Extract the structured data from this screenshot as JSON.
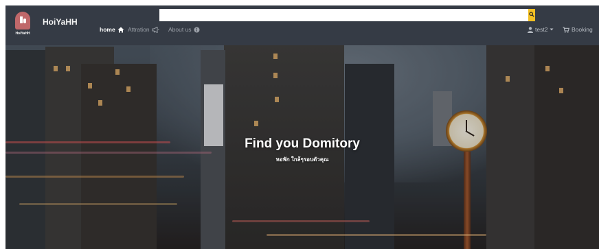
{
  "navbar": {
    "logo_text": "HoiYaHH",
    "brand": "HoiYaHH",
    "search": {
      "value": "",
      "placeholder": ""
    },
    "links": {
      "home": "home",
      "attraction": "Attration",
      "about": "About us"
    },
    "user": "test2",
    "booking": "Booking"
  },
  "hero": {
    "title": "Find you Domitory",
    "subtitle": "หอพัก ใกล้ๆรอบตัวคุณ"
  },
  "colors": {
    "navbar_bg": "#353b45",
    "search_button": "#f2bf24",
    "logo_red": "#c0686a",
    "nav_active": "#ffffff",
    "nav_muted": "#9ba0a8"
  },
  "icons": {
    "home": "home-icon",
    "attraction": "bullhorn-icon",
    "about": "info-circle-icon",
    "user": "user-icon",
    "user_dropdown": "caret-down-icon",
    "booking": "cart-icon",
    "search": "search-icon"
  }
}
